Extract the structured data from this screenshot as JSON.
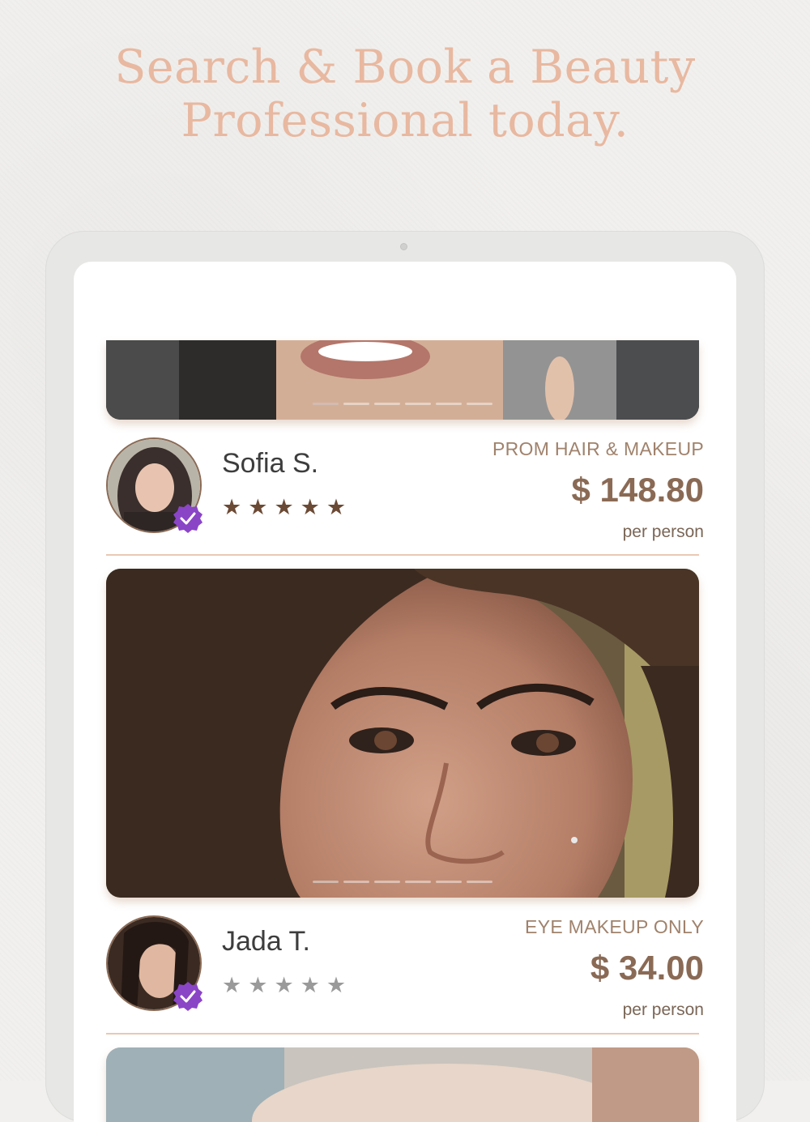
{
  "headline": {
    "line1": "Search & Book a Beauty",
    "line2": "Professional today."
  },
  "listings": [
    {
      "name": "Sofia S.",
      "service": "PROM HAIR & MAKEUP",
      "price": "$ 148.80",
      "unit": "per person",
      "rating": 5,
      "verified": true,
      "star_color": "#6b4a35"
    },
    {
      "name": "Jada T.",
      "service": "EYE MAKEUP ONLY",
      "price": "$ 34.00",
      "unit": "per person",
      "rating": 0,
      "verified": true,
      "star_color": "#9a9a9a"
    }
  ],
  "colors": {
    "headline": "#e8b8a0",
    "accent_brown": "#8a6a55",
    "verified_badge": "#8a45c7",
    "divider": "#e9c8b3"
  },
  "icons": {
    "star": "star-icon",
    "verified": "verified-badge-icon"
  }
}
